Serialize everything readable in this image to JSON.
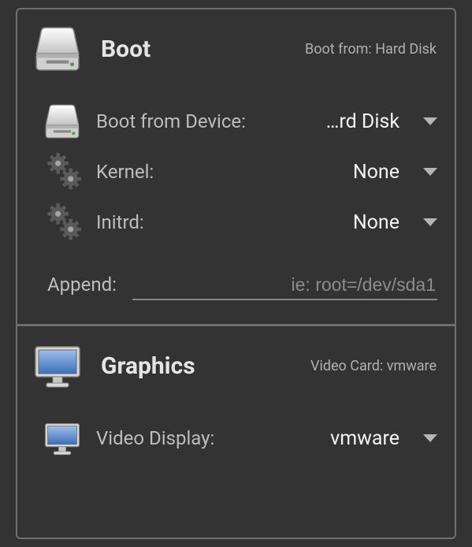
{
  "boot": {
    "title": "Boot",
    "summary": "Boot from: Hard Disk",
    "device_label": "Boot from Device:",
    "device_value": "…rd Disk",
    "kernel_label": "Kernel:",
    "kernel_value": "None",
    "initrd_label": "Initrd:",
    "initrd_value": "None",
    "append_label": "Append:",
    "append_value": "",
    "append_placeholder": "ie: root=/dev/sda1"
  },
  "graphics": {
    "title": "Graphics",
    "summary": "Video Card: vmware",
    "video_display_label": "Video Display:",
    "video_display_value": "vmware"
  },
  "icons": {
    "disk": "drive-icon",
    "gears": "gears-icon",
    "monitor": "monitor-icon",
    "caret": "dropdown-caret-icon"
  }
}
